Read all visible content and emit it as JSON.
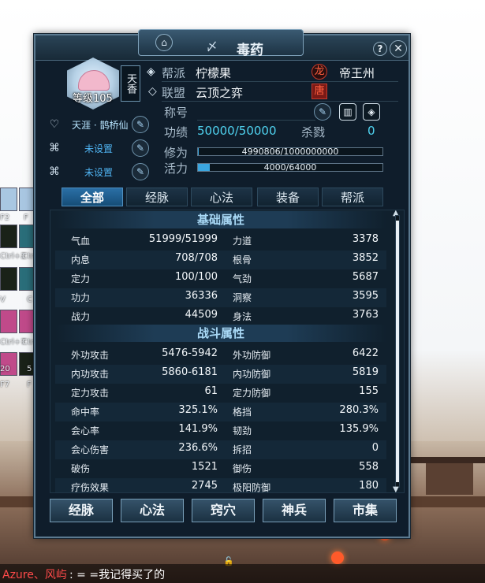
{
  "window": {
    "title": "毒药",
    "title_symbol": "〆",
    "help_label": "?",
    "close_label": "✕"
  },
  "avatar": {
    "level": "等级105",
    "school": "天香"
  },
  "side_skills": [
    {
      "label": "天涯 · 鹊桥仙",
      "icon": "heart-charm-icon",
      "button_icon": "quill-icon"
    },
    {
      "label": "未设置",
      "icon": "ribbon-knot-icon",
      "button_icon": "quill-icon"
    },
    {
      "label": "未设置",
      "icon": "ribbon-knot-icon",
      "button_icon": "quill-icon"
    }
  ],
  "info": {
    "guild_label": "帮派",
    "guild_value": "柠檬果",
    "alliance_label": "联盟",
    "alliance_value": "云顶之弈",
    "dragon_tag": "龙",
    "tang_tag": "唐",
    "region": "帝王州",
    "title_label": "称号",
    "merit_label": "功绩",
    "merit_value": "50000/50000",
    "kill_label": "杀戮",
    "kill_value": "0",
    "cultivation_label": "修为",
    "cultivation_value": "4990806/1000000000",
    "cultivation_fraction": 0.005,
    "vitality_label": "活力",
    "vitality_value": "4000/64000",
    "vitality_fraction": 0.0625
  },
  "tabs": [
    "全部",
    "经脉",
    "心法",
    "装备",
    "帮派"
  ],
  "active_tab": 0,
  "sections": {
    "basic": {
      "title": "基础属性",
      "rows": [
        {
          "l1": "气血",
          "v1": "51999/51999",
          "l2": "力道",
          "v2": "3378"
        },
        {
          "l1": "内息",
          "v1": "708/708",
          "l2": "根骨",
          "v2": "3852"
        },
        {
          "l1": "定力",
          "v1": "100/100",
          "l2": "气劲",
          "v2": "5687"
        },
        {
          "l1": "功力",
          "v1": "36336",
          "l2": "洞察",
          "v2": "3595"
        },
        {
          "l1": "战力",
          "v1": "44509",
          "l2": "身法",
          "v2": "3763"
        }
      ]
    },
    "combat": {
      "title": "战斗属性",
      "rows": [
        {
          "l1": "外功攻击",
          "v1": "5476-5942",
          "l2": "外功防御",
          "v2": "6422"
        },
        {
          "l1": "内功攻击",
          "v1": "5860-6181",
          "l2": "内功防御",
          "v2": "5819"
        },
        {
          "l1": "定力攻击",
          "v1": "61",
          "l2": "定力防御",
          "v2": "155"
        },
        {
          "l1": "命中率",
          "v1": "325.1%",
          "l2": "格挡",
          "v2": "280.3%"
        },
        {
          "l1": "会心率",
          "v1": "141.9%",
          "l2": "韧劲",
          "v2": "135.9%"
        },
        {
          "l1": "会心伤害",
          "v1": "236.6%",
          "l2": "拆招",
          "v2": "0"
        },
        {
          "l1": "破伤",
          "v1": "1521",
          "l2": "御伤",
          "v2": "558"
        },
        {
          "l1": "疗伤效果",
          "v1": "2745",
          "l2": "极阳防御",
          "v2": "180"
        }
      ]
    }
  },
  "bottom_buttons": [
    "经脉",
    "心法",
    "窍穴",
    "神兵",
    "市集"
  ],
  "hotbar_labels": [
    "F2",
    "F",
    "Ctrl+2",
    "Ctr",
    "V",
    "C",
    "Ctrl+7",
    "Ctr",
    "20",
    "5",
    "F7",
    "F"
  ],
  "chat": {
    "name": "Azure、风屿",
    "message": ": = =我记得买了的"
  }
}
